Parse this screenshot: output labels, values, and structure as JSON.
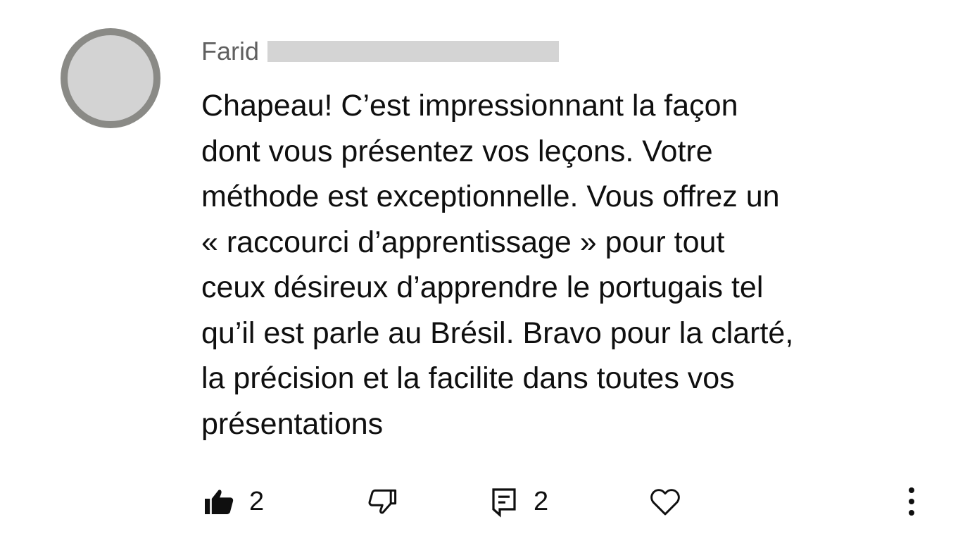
{
  "comment": {
    "author_name": "Farid",
    "text": "Chapeau!  C’est impressionnant la façon\ndont vous présentez vos leçons. Votre\nméthode est exceptionnelle. Vous offrez un\n« raccourci d’apprentissage » pour tout\nceux désireux  d’apprendre le portugais tel\nqu’il est parle au Brésil. Bravo pour la clarté,\nla précision et la facilite dans toutes vos\nprésentations"
  },
  "actions": {
    "like_count": "2",
    "reply_count": "2",
    "icons": {
      "like": "thumbs-up-filled-icon",
      "dislike": "thumbs-down-outline-icon",
      "replies": "comment-bubble-icon",
      "heart": "heart-outline-icon",
      "more": "vertical-ellipsis-icon"
    }
  },
  "colors": {
    "text": "#0f0f0f",
    "author": "#606060",
    "redaction": "#d4d4d4",
    "avatar_ring": "#8a8a86",
    "avatar_blur": "#d3d3d3"
  }
}
